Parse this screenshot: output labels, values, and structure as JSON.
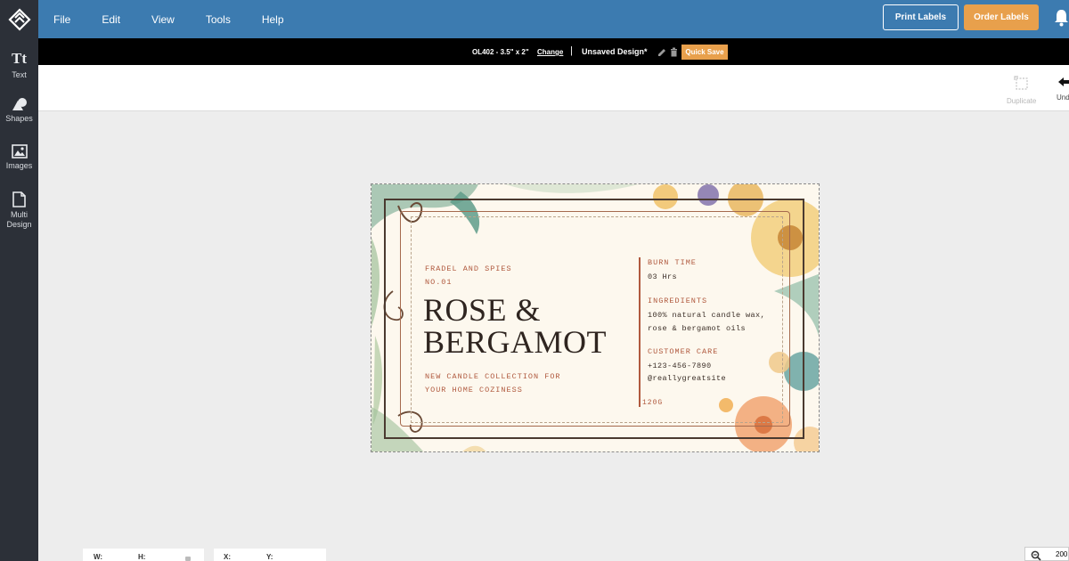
{
  "menu": [
    "File",
    "Edit",
    "View",
    "Tools",
    "Help"
  ],
  "header": {
    "print_label": "Print Labels",
    "order_label": "Order Labels"
  },
  "sidebar": [
    {
      "label": "Text",
      "icon": "text-icon"
    },
    {
      "label": "Shapes",
      "icon": "shapes-icon"
    },
    {
      "label": "Images",
      "icon": "images-icon"
    },
    {
      "label": "Multi Design",
      "icon": "document-icon"
    }
  ],
  "subbar": {
    "size": "OL402 - 3.5\" x 2\"",
    "change": "Change",
    "separator": "|",
    "design_name": "Unsaved Design*",
    "quick_save": "Quick Save"
  },
  "toolbar": {
    "duplicate": "Duplicate",
    "undo": "Und"
  },
  "label": {
    "brand": "FRADEL AND SPIES",
    "number": "NO.01",
    "title_line1": "ROSE &",
    "title_line2": "BERGAMOT",
    "tagline_line1": "NEW CANDLE COLLECTION FOR",
    "tagline_line2": "YOUR HOME COZINESS",
    "burn_label": "BURN TIME",
    "burn_value": "03 Hrs",
    "ingredients_label": "INGREDIENTS",
    "ingredients_line1": "100% natural candle wax,",
    "ingredients_line2": "rose & bergamot oils",
    "care_label": "CUSTOMER CARE",
    "care_phone": "+123-456-7890",
    "care_site": "@reallygreatsite",
    "weight": "120G"
  },
  "bottom": {
    "w": "W:",
    "h": "H:",
    "x": "X:",
    "y": "Y:",
    "zoom": "200"
  },
  "colors": {
    "topbar": "#3c7bb0",
    "sidebar": "#2c3038",
    "accent": "#e8a04c",
    "label_accent": "#b0593e"
  }
}
